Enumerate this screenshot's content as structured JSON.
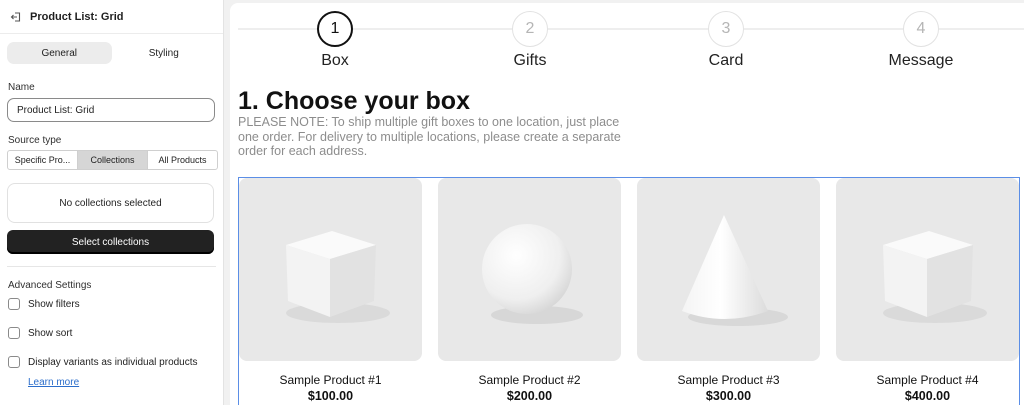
{
  "sidebar": {
    "header_title": "Product List: Grid",
    "back_icon": "exit-icon",
    "tabs": [
      "General",
      "Styling"
    ],
    "name_label": "Name",
    "name_value": "Product List: Grid",
    "source_label": "Source type",
    "source_options": [
      "Specific Pro...",
      "Collections",
      "All Products"
    ],
    "source_selected": "Collections",
    "empty_text": "No collections selected",
    "select_button": "Select collections",
    "advanced_label": "Advanced Settings",
    "checkboxes": [
      "Show filters",
      "Show sort",
      "Display variants as individual products"
    ],
    "learn_more": "Learn more"
  },
  "steps": [
    {
      "number": "1",
      "label": "Box",
      "active": true
    },
    {
      "number": "2",
      "label": "Gifts",
      "active": false
    },
    {
      "number": "3",
      "label": "Card",
      "active": false
    },
    {
      "number": "4",
      "label": "Message",
      "active": false
    }
  ],
  "main": {
    "heading": "1. Choose your box",
    "note": "PLEASE NOTE: To ship multiple gift boxes to one location, just place one order. For delivery to multiple locations, please create a separate order for each address."
  },
  "products": [
    {
      "name": "Sample Product #1",
      "price": "$100.00",
      "shape": "cube"
    },
    {
      "name": "Sample Product #2",
      "price": "$200.00",
      "shape": "sphere"
    },
    {
      "name": "Sample Product #3",
      "price": "$300.00",
      "shape": "cone"
    },
    {
      "name": "Sample Product #4",
      "price": "$400.00",
      "shape": "cube"
    }
  ],
  "colors": {
    "accent_border": "#5b8ee6",
    "primary_button": "#222222",
    "link": "#2c6ecb"
  }
}
